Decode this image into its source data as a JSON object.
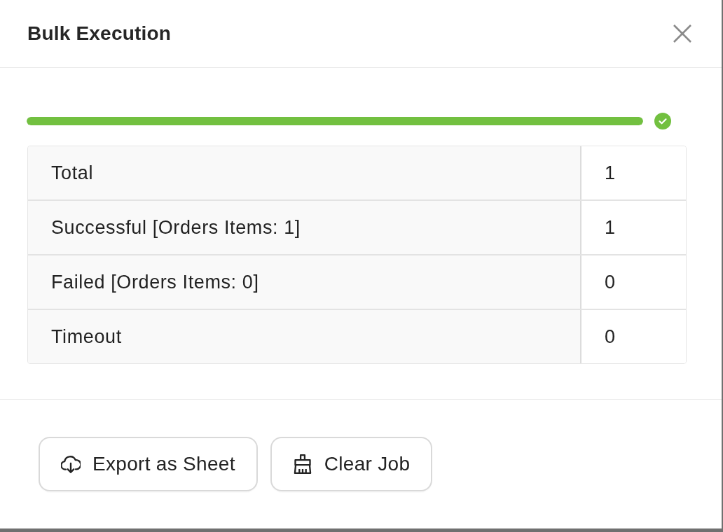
{
  "dialog": {
    "title": "Bulk Execution"
  },
  "progress": {
    "level": 1,
    "complete": true
  },
  "summary": {
    "rows": [
      {
        "label": "Total",
        "value": "1"
      },
      {
        "label": "Successful [Orders Items: 1]",
        "value": "1"
      },
      {
        "label": "Failed [Orders Items: 0]",
        "value": "0"
      },
      {
        "label": "Timeout",
        "value": "0"
      }
    ]
  },
  "buttons": [
    {
      "kind": "export",
      "label": "Export as Sheet"
    },
    {
      "kind": "clear",
      "label": "Clear Job"
    }
  ]
}
